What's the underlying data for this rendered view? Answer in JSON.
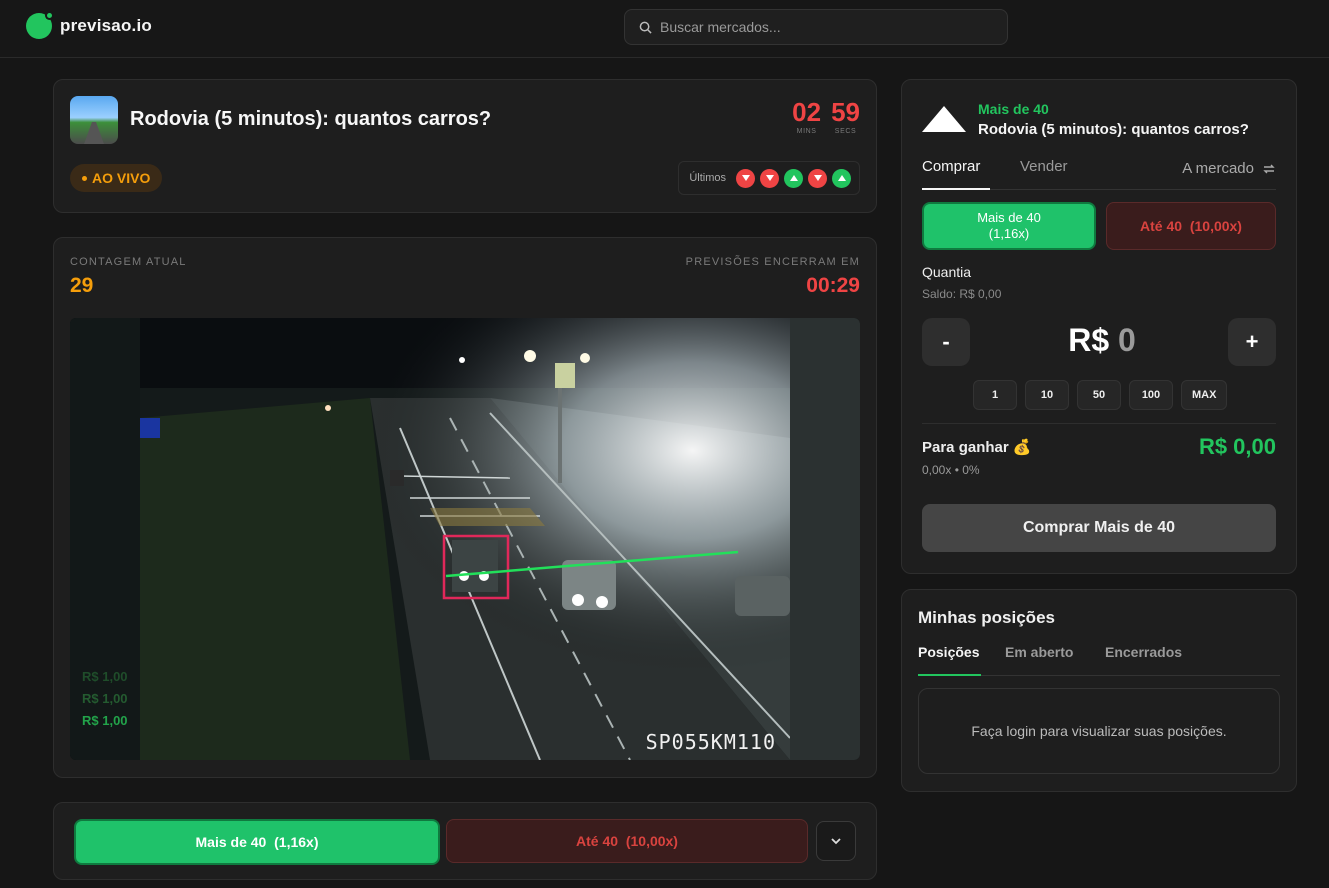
{
  "app": {
    "brand": "previsao.io",
    "accent": "#22c55e"
  },
  "search": {
    "placeholder": "Buscar mercados..."
  },
  "market": {
    "title": "Rodovia (5 minutos): quantos carros?",
    "timer": {
      "mins": "02",
      "mins_label": "MINS",
      "secs": "59",
      "secs_label": "SECS"
    },
    "live_label": "AO VIVO",
    "last_label": "Últimos",
    "last_results": [
      "down",
      "down",
      "up",
      "down",
      "up"
    ]
  },
  "count": {
    "current_label": "CONTAGEM ATUAL",
    "current_value": "29",
    "closes_label": "PREVISÕES ENCERRAM EM",
    "closes_value": "00:29",
    "camera_label": "SP055KM110",
    "ghost_values": [
      "R$ 1,00",
      "R$ 1,00",
      "R$ 1,00"
    ]
  },
  "bottom_bar": {
    "yes_label": "Mais de 40",
    "yes_odds": "(1,16x)",
    "no_label": "Até 40",
    "no_odds": "(10,00x)"
  },
  "trade": {
    "selected_outcome": "Mais de 40",
    "market_title": "Rodovia (5 minutos): quantos carros?",
    "tabs": {
      "buy": "Comprar",
      "sell": "Vender",
      "order_type": "A mercado"
    },
    "yes_label": "Mais de 40",
    "yes_odds": "(1,16x)",
    "no_label": "Até 40",
    "no_odds": "(10,00x)",
    "quantity_label": "Quantia",
    "balance": "Saldo: R$ 0,00",
    "minus": "-",
    "plus": "+",
    "currency": "R$",
    "amount": "0",
    "chips": [
      "1",
      "10",
      "50",
      "100",
      "MAX"
    ],
    "gain_label": "Para ganhar 💰",
    "gain_sub": "0,00x • 0%",
    "gain_value": "R$ 0,00",
    "buy_button": "Comprar Mais de 40"
  },
  "positions": {
    "title": "Minhas posições",
    "tabs": [
      "Posições",
      "Em aberto",
      "Encerrados"
    ],
    "empty": "Faça login para visualizar suas posições."
  }
}
